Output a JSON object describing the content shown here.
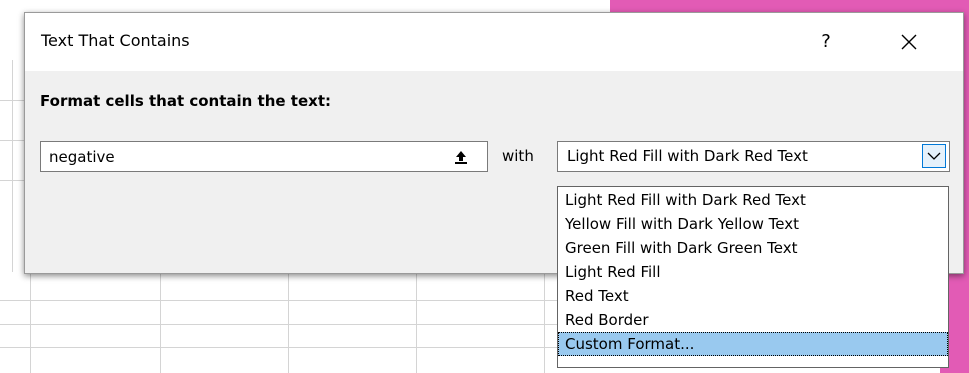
{
  "dialog": {
    "title": "Text That Contains",
    "help_label": "?",
    "close_label": "×",
    "prompt": "Format cells that contain the text:",
    "text_value": "negative",
    "with_label": "with",
    "format_selected": "Light Red Fill with Dark Red Text",
    "options": [
      "Light Red Fill with Dark Red Text",
      "Yellow Fill with Dark Yellow Text",
      "Green Fill with Dark Green Text",
      "Light Red Fill",
      "Red Text",
      "Red Border",
      "Custom Format..."
    ],
    "highlighted_option": "Custom Format..."
  },
  "colors": {
    "dialog_bg": "#f0f0f0",
    "highlight": "#99c9ef",
    "accent_border": "#0078d7",
    "background_accent": "#e25bb5"
  },
  "icons": {
    "collapse": "upload-arrow-icon",
    "dropdown": "chevron-down-icon",
    "close": "close-icon"
  }
}
